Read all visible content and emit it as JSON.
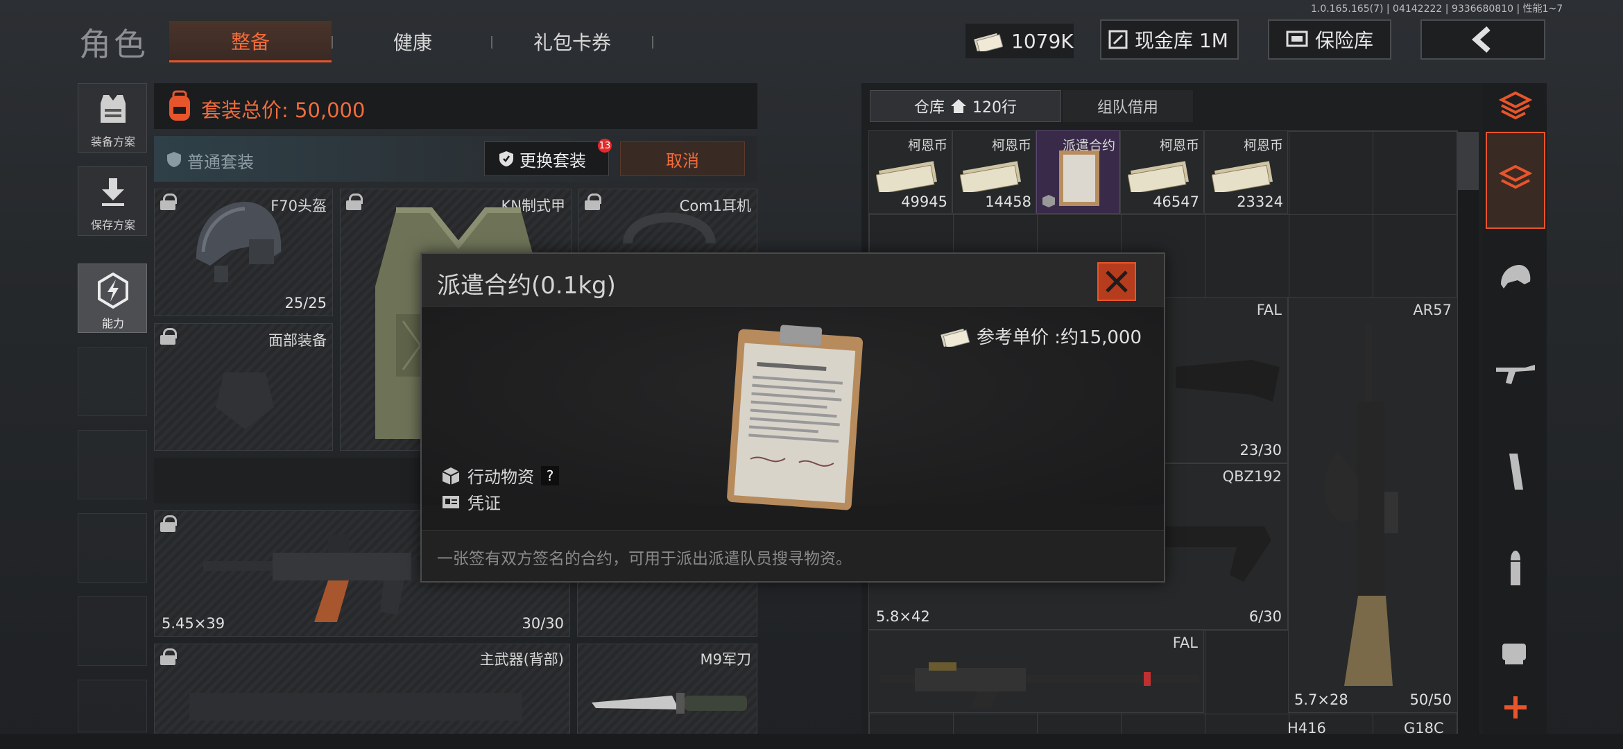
{
  "version": "1.0.165.165(7) | 04142222 | 9336680810 | 性能1~7",
  "header": {
    "title": "角色",
    "tabs": [
      "整备",
      "健康",
      "礼包卡券"
    ],
    "active_tab": "整备",
    "currency": "1079K",
    "cash_vault": "现金库 1M",
    "insurance": "保险库"
  },
  "left_menu": {
    "loadout_plan": "装备方案",
    "save_plan": "保存方案",
    "ability": "能力"
  },
  "loadout": {
    "total_value": "套装总价: 50,000",
    "preset_name": "普通套装",
    "change_button": "更换套装",
    "change_badge": "13",
    "cancel_button": "取消",
    "slots": {
      "helmet": {
        "name": "F70头盔",
        "durability": "25/25"
      },
      "armor": {
        "name": "KN制式甲"
      },
      "headset": {
        "name": "Com1耳机"
      },
      "face": {
        "name": "面部装备"
      },
      "primary": {
        "caliber": "5.45×39",
        "ammo": "30/30"
      },
      "primary_back": {
        "name": "主武器(背部)"
      },
      "knife": {
        "name": "M9军刀"
      }
    }
  },
  "stash": {
    "tab_storage": "仓库",
    "rows": "120行",
    "tab_team": "组队借用",
    "items": [
      {
        "name": "柯恩币",
        "count": "49945"
      },
      {
        "name": "柯恩币",
        "count": "14458"
      },
      {
        "name": "派遣合约",
        "count": ""
      },
      {
        "name": "柯恩币",
        "count": "46547"
      },
      {
        "name": "柯恩币",
        "count": "23324"
      }
    ],
    "weapons": {
      "fal1": {
        "name": "FAL",
        "ammo": "23/30"
      },
      "ar57": {
        "name": "AR57",
        "caliber": "5.7×28",
        "ammo": "50/50"
      },
      "qbz": {
        "name": "QBZ192",
        "caliber": "5.8×42",
        "ammo": "6/30"
      },
      "fal2": {
        "name": "FAL"
      },
      "h416": {
        "name": "H416"
      },
      "g18c": {
        "name": "G18C"
      }
    }
  },
  "modal": {
    "title": "派遣合约(0.1kg)",
    "price_label": "参考单价 :约15,000",
    "tag1": "行动物资",
    "tag1_help": "?",
    "tag2": "凭证",
    "description": "一张签有双方签名的合约，可用于派出派遣队员搜寻物资。"
  },
  "colors": {
    "accent": "#e8552b",
    "accent_bg": "#3b2a22",
    "modal_bg": "#1c1c1d"
  }
}
